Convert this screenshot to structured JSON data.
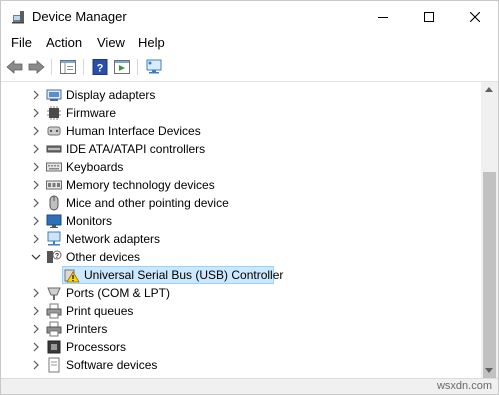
{
  "window": {
    "title": "Device Manager"
  },
  "menu": [
    "File",
    "Action",
    "View",
    "Help"
  ],
  "tree": {
    "categories": [
      {
        "label": "Display adapters",
        "icon": "display-adapter-icon"
      },
      {
        "label": "Firmware",
        "icon": "firmware-icon"
      },
      {
        "label": "Human Interface Devices",
        "icon": "hid-icon"
      },
      {
        "label": "IDE ATA/ATAPI controllers",
        "icon": "ide-controller-icon"
      },
      {
        "label": "Keyboards",
        "icon": "keyboard-icon"
      },
      {
        "label": "Memory technology devices",
        "icon": "memory-icon"
      },
      {
        "label": "Mice and other pointing device",
        "icon": "mouse-icon"
      },
      {
        "label": "Monitors",
        "icon": "monitor-icon"
      },
      {
        "label": "Network adapters",
        "icon": "network-adapter-icon"
      },
      {
        "label": "Other devices",
        "icon": "unknown-device-icon",
        "expanded": true
      },
      {
        "label": "Universal Serial Bus (USB) Controller",
        "icon": "warning-icon",
        "child": true,
        "selected": true
      },
      {
        "label": "Ports (COM & LPT)",
        "icon": "port-icon"
      },
      {
        "label": "Print queues",
        "icon": "print-queue-icon"
      },
      {
        "label": "Printers",
        "icon": "printer-icon"
      },
      {
        "label": "Processors",
        "icon": "processor-icon"
      },
      {
        "label": "Software devices",
        "icon": "software-device-icon"
      }
    ]
  },
  "watermark": "wsxdn.com",
  "colors": {
    "selection": "#cce8ff",
    "selection_border": "#99d1ff"
  }
}
